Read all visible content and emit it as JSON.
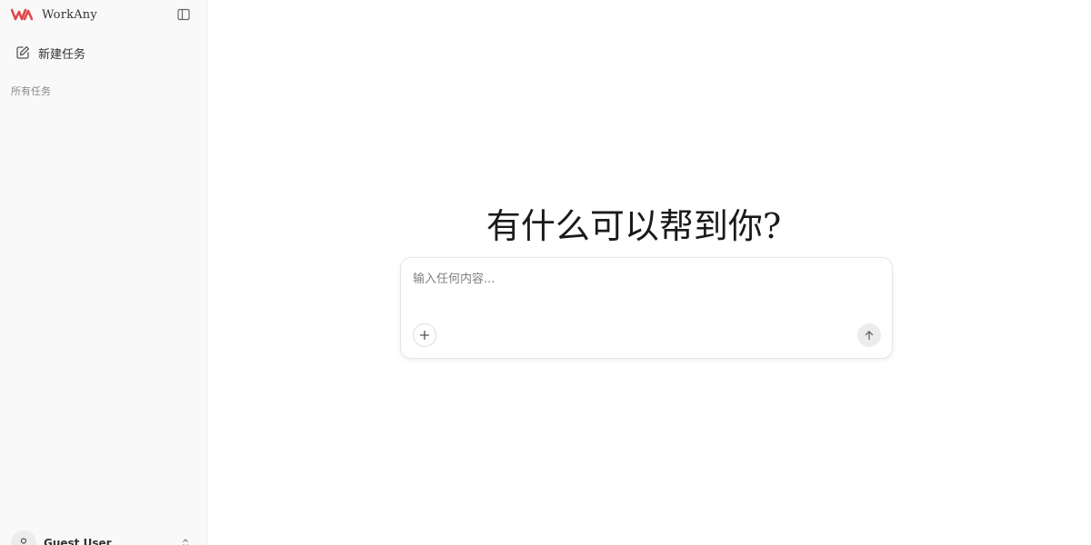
{
  "app": {
    "title": "WorkAny",
    "brand_color": "#e0484b"
  },
  "sidebar": {
    "new_task_label": "新建任务",
    "section_label": "所有任务",
    "user": {
      "name": "Guest User"
    },
    "icons": {
      "toggle": "sidebar-toggle-icon",
      "new_task": "edit-icon",
      "avatar": "user-icon",
      "chevron": "chevron-up-down-icon"
    }
  },
  "main": {
    "headline": "有什么可以帮到你?",
    "composer": {
      "placeholder": "输入任何内容...",
      "value": "",
      "attach_icon": "plus-icon",
      "send_icon": "arrow-up-icon"
    }
  }
}
